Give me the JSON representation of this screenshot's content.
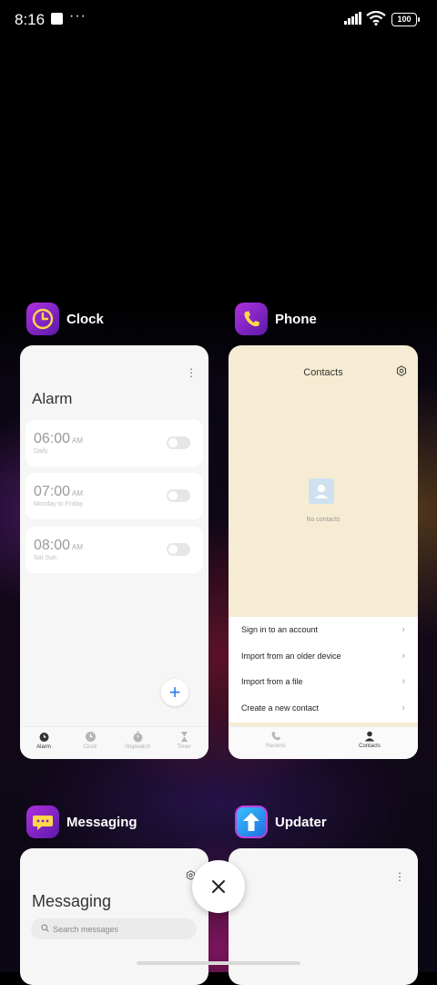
{
  "status_bar": {
    "time": "8:16",
    "battery": "100"
  },
  "apps": {
    "clock": {
      "name": "Clock",
      "title": "Alarm",
      "alarms": [
        {
          "time": "06:00",
          "ampm": "AM",
          "repeat": "Daily"
        },
        {
          "time": "07:00",
          "ampm": "AM",
          "repeat": "Monday to Friday"
        },
        {
          "time": "08:00",
          "ampm": "AM",
          "repeat": "Sat Sun"
        }
      ],
      "nav": [
        "Alarm",
        "Clock",
        "Stopwatch",
        "Timer"
      ]
    },
    "phone": {
      "name": "Phone",
      "title": "Contacts",
      "empty_text": "No contacts",
      "menu": [
        "Sign in to an account",
        "Import from an older device",
        "Import from a file",
        "Create a new contact"
      ],
      "nav": [
        "Recents",
        "Contacts"
      ]
    },
    "messaging": {
      "name": "Messaging",
      "title": "Messaging",
      "search_placeholder": "Search messages"
    },
    "updater": {
      "name": "Updater"
    }
  }
}
